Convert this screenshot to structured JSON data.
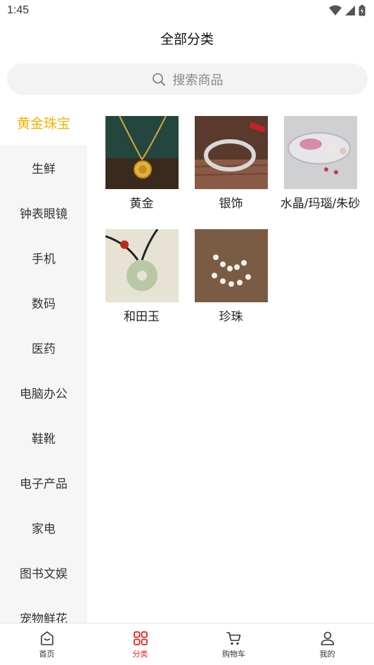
{
  "status": {
    "time": "1:45"
  },
  "header": {
    "title": "全部分类"
  },
  "search": {
    "placeholder": "搜索商品"
  },
  "sidebar": {
    "items": [
      {
        "label": "黄金珠宝",
        "active": true
      },
      {
        "label": "生鲜"
      },
      {
        "label": "钟表眼镜"
      },
      {
        "label": "手机"
      },
      {
        "label": "数码"
      },
      {
        "label": "医药"
      },
      {
        "label": "电脑办公"
      },
      {
        "label": "鞋靴"
      },
      {
        "label": "电子产品"
      },
      {
        "label": "家电"
      },
      {
        "label": "图书文娱"
      },
      {
        "label": "宠物鲜花"
      }
    ]
  },
  "categories": [
    {
      "label": "黄金",
      "image": "gold-necklace-image"
    },
    {
      "label": "银饰",
      "image": "silver-bracelet-image"
    },
    {
      "label": "水晶/玛瑙/朱砂",
      "image": "crystal-dish-image"
    },
    {
      "label": "和田玉",
      "image": "jade-pendant-image"
    },
    {
      "label": "珍珠",
      "image": "pearl-necklace-image"
    }
  ],
  "tabbar": {
    "items": [
      {
        "label": "首页",
        "icon": "home-icon"
      },
      {
        "label": "分类",
        "icon": "category-grid-icon",
        "active": true
      },
      {
        "label": "购物车",
        "icon": "cart-icon"
      },
      {
        "label": "我的",
        "icon": "profile-icon"
      }
    ]
  },
  "colors": {
    "accent": "#f0b400",
    "tab_active": "#e2231a",
    "sidebar_bg": "#f6f6f6"
  }
}
